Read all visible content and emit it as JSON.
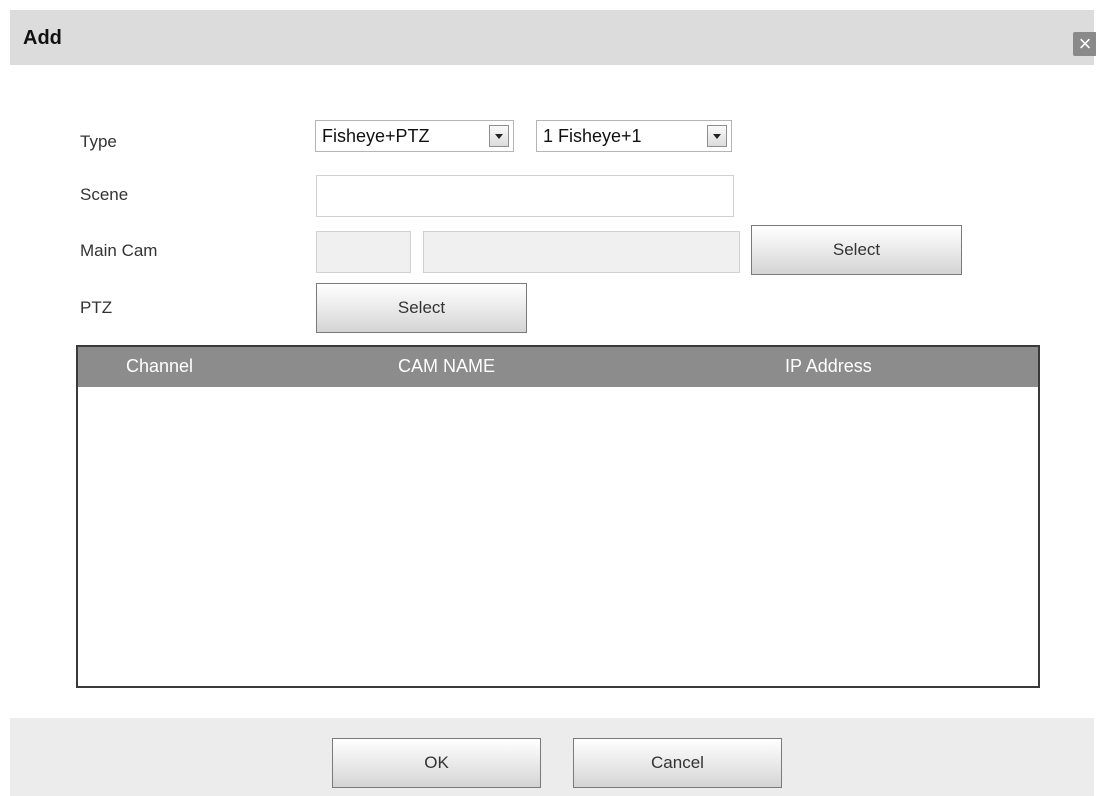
{
  "dialog": {
    "title": "Add",
    "close_icon": "×"
  },
  "form": {
    "type_label": "Type",
    "type_value": "Fisheye+PTZ",
    "mode_value": "1 Fisheye+1",
    "scene_label": "Scene",
    "scene_value": "",
    "main_cam_label": "Main Cam",
    "main_cam_channel": "",
    "main_cam_name": "",
    "main_cam_select": "Select",
    "ptz_label": "PTZ",
    "ptz_select": "Select"
  },
  "table": {
    "columns": [
      "Channel",
      "CAM NAME",
      "IP Address"
    ],
    "rows": []
  },
  "footer": {
    "ok_label": "OK",
    "cancel_label": "Cancel"
  }
}
